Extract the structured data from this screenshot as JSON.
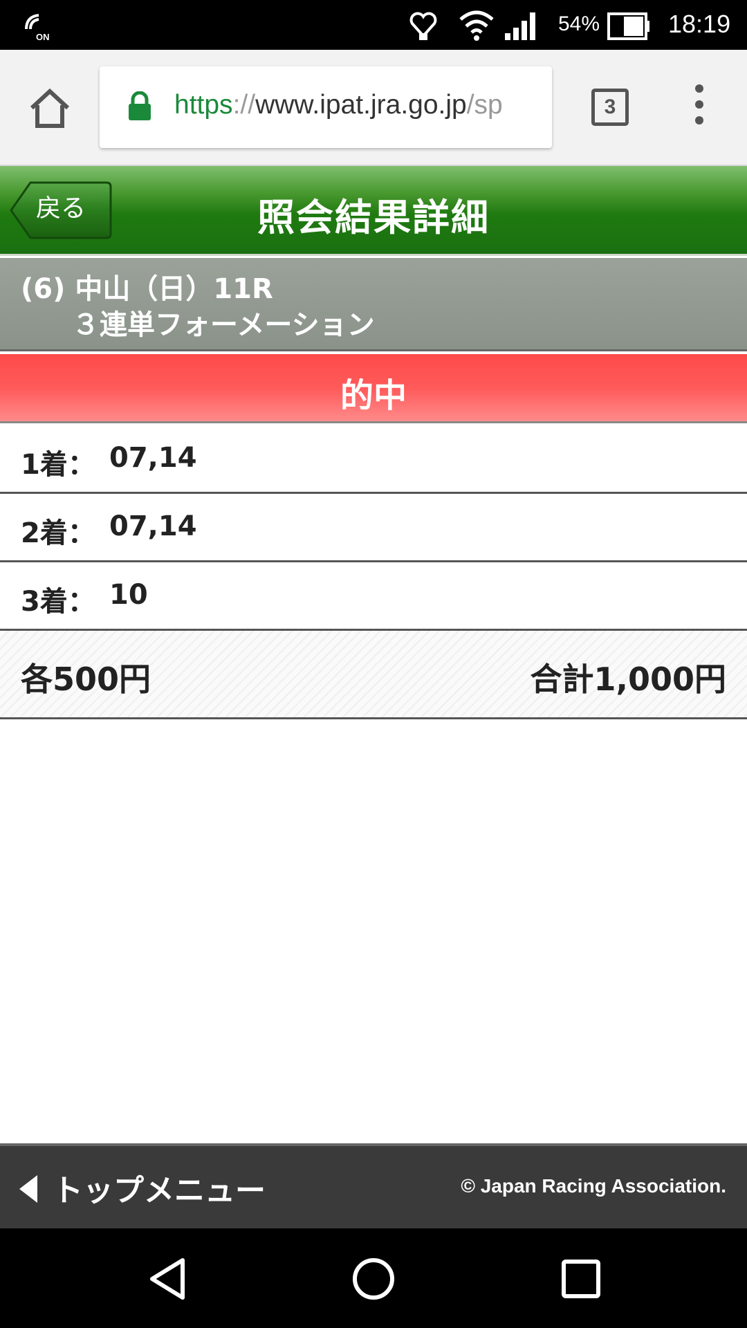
{
  "status_bar": {
    "battery_percent": "54%",
    "time": "18:19",
    "icons": [
      "nfc-on-icon",
      "heart-rate-icon",
      "wifi-icon",
      "signal-icon",
      "battery-icon"
    ]
  },
  "browser": {
    "url_scheme": "https",
    "url_sep": "://",
    "url_host": "www.ipat.jra.go.jp",
    "url_path": "/sp",
    "tab_count": "3"
  },
  "header": {
    "back_label": "戻る",
    "title": "照会結果詳細"
  },
  "race": {
    "line1": "(6) 中山（日）11R",
    "line2": "３連単フォーメーション"
  },
  "result": {
    "status": "的中",
    "rows": [
      {
        "label": "1着：",
        "value": "07,14"
      },
      {
        "label": "2着：",
        "value": "07,14"
      },
      {
        "label": "3着：",
        "value": "10"
      }
    ],
    "each_amount": "各500円",
    "total_amount": "合計1,000円"
  },
  "footer": {
    "top_menu_label": "トップメニュー",
    "copyright": "© Japan Racing Association."
  },
  "colors": {
    "header_green": "#1f7a10",
    "hit_red": "#ff4a4a",
    "url_green": "#1a8a3a",
    "footer_bg": "#3a3a3a"
  }
}
